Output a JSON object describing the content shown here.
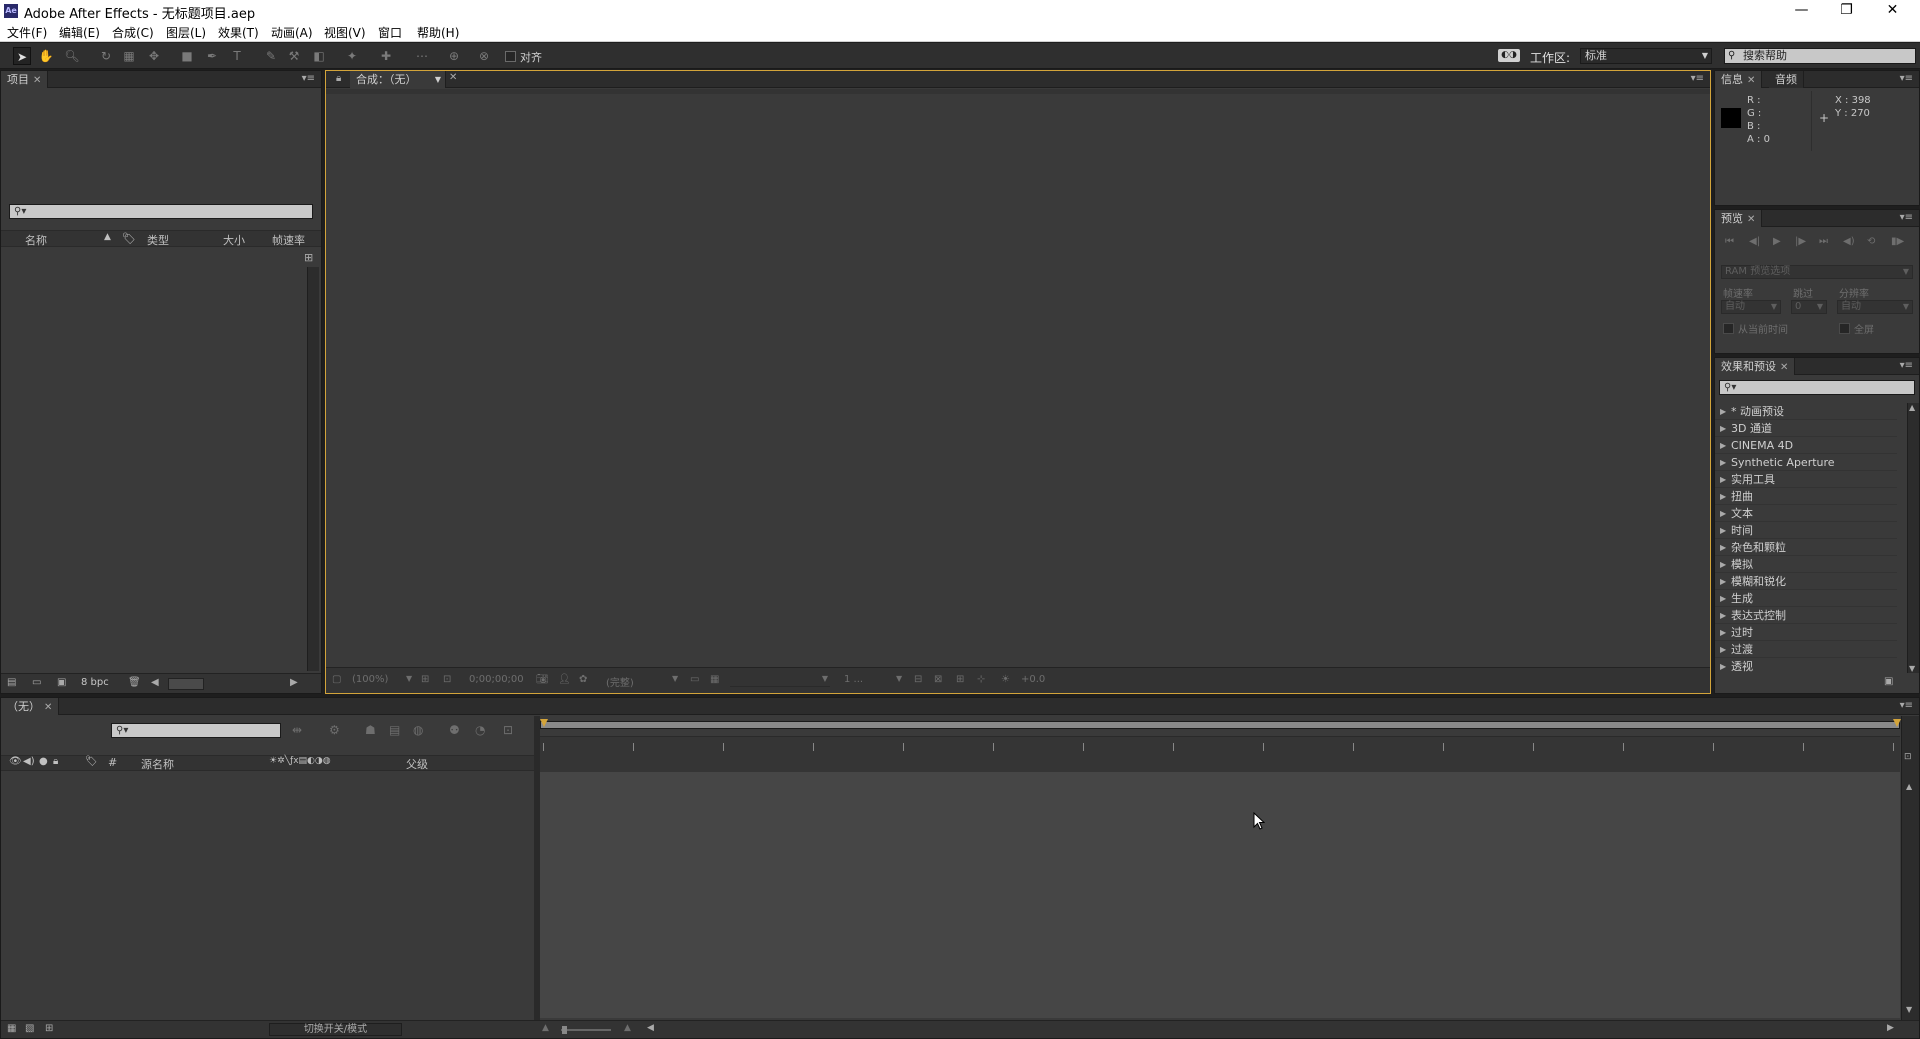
{
  "window": {
    "title": "Adobe After Effects - 无标题项目.aep",
    "app_icon": "Ae",
    "controls": {
      "minimize": "—",
      "restore": "❐",
      "close": "✕"
    }
  },
  "menu": [
    "文件(F)",
    "编辑(E)",
    "合成(C)",
    "图层(L)",
    "效果(T)",
    "动画(A)",
    "视图(V)",
    "窗口",
    "帮助(H)"
  ],
  "toolbar": {
    "snap_label": "对齐",
    "workspace_label": "工作区:",
    "workspace_value": "标准",
    "help_search_placeholder": "搜索帮助"
  },
  "project_panel": {
    "tab": "项目",
    "columns": {
      "name": "名称",
      "type": "类型",
      "size": "大小",
      "framerate": "帧速率"
    },
    "bpc": "8 bpc"
  },
  "comp_panel": {
    "tab": "合成：（无）",
    "zoom": "(100%)",
    "timecode": "0;00;00;00",
    "resolution": "(完整)",
    "view_count": "1 ...",
    "exposure": "+0.0"
  },
  "info_panel": {
    "tabs": [
      "信息",
      "音频"
    ],
    "r_label": "R :",
    "g_label": "G :",
    "b_label": "B :",
    "a_label": "A : 0",
    "x": "X : 398",
    "y": "Y : 270"
  },
  "preview_panel": {
    "tab": "预览",
    "ram_options": "RAM 预览选项",
    "framerate_label": "帧速率",
    "skip_label": "跳过",
    "resolution_label": "分辨率",
    "framerate_value": "自动",
    "skip_value": "0",
    "resolution_value": "自动",
    "from_current": "从当前时间",
    "fullscreen": "全屏"
  },
  "effects_panel": {
    "tab": "效果和预设",
    "items": [
      "* 动画预设",
      "3D 通道",
      "CINEMA 4D",
      "Synthetic Aperture",
      "实用工具",
      "扭曲",
      "文本",
      "时间",
      "杂色和颗粒",
      "模拟",
      "模糊和锐化",
      "生成",
      "表达式控制",
      "过时",
      "过渡",
      "透视"
    ]
  },
  "timeline_panel": {
    "tab": "（无）",
    "columns": {
      "hash": "#",
      "source_name": "源名称",
      "parent": "父级"
    },
    "toggle_label": "切换开关/模式"
  }
}
